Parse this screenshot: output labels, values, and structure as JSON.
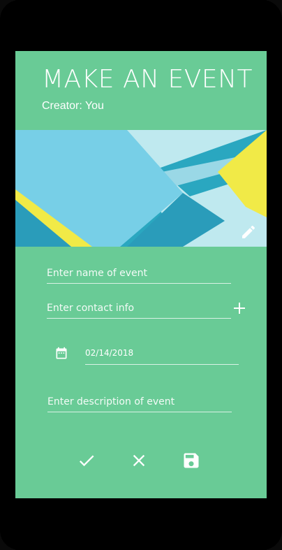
{
  "header": {
    "title": "MAKE AN EVENT",
    "creator": "Creator: You"
  },
  "banner": {
    "edit_icon": "pencil-icon"
  },
  "form": {
    "name_placeholder": "Enter name of event",
    "contact_placeholder": "Enter contact info",
    "add_icon": "plus-icon",
    "calendar_icon": "calendar-icon",
    "date_value": "02/14/2018",
    "description_placeholder": "Enter description of event"
  },
  "actions": {
    "confirm_icon": "check-icon",
    "cancel_icon": "close-icon",
    "save_icon": "save-icon"
  },
  "colors": {
    "accent": "#69cb96",
    "banner_blue": "#2aa7c0",
    "banner_light_blue": "#77cfe7",
    "banner_yellow": "#f1ea47",
    "text": "#ffffff"
  }
}
